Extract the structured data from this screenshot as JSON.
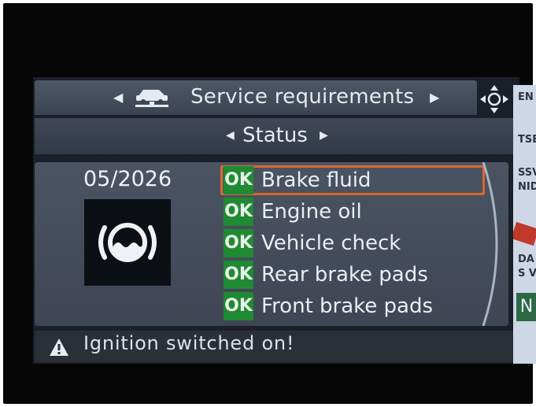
{
  "header": {
    "title": "Service requirements",
    "icon": "car-lift-icon",
    "controller_icon": "navigation-controller-icon"
  },
  "subheader": {
    "title": "Status"
  },
  "detail": {
    "date": "05/2026",
    "icon": "brake-fluid-icon"
  },
  "service_items": [
    {
      "status": "OK",
      "label": "Brake fluid",
      "selected": true
    },
    {
      "status": "OK",
      "label": "Engine oil",
      "selected": false
    },
    {
      "status": "OK",
      "label": "Vehicle check",
      "selected": false
    },
    {
      "status": "OK",
      "label": "Rear brake pads",
      "selected": false
    },
    {
      "status": "OK",
      "label": "Front brake pads",
      "selected": false
    }
  ],
  "warning": {
    "icon": "warning-triangle-icon",
    "text": "Ignition switched on!"
  },
  "map_fragment": {
    "labels": [
      "EN",
      "TSE",
      "SSV",
      "NID",
      "DA",
      "S V"
    ],
    "button_label": "N"
  },
  "colors": {
    "ok_badge": "#1f8a32",
    "selection": "#d8692c",
    "panel": "#4b5463"
  }
}
